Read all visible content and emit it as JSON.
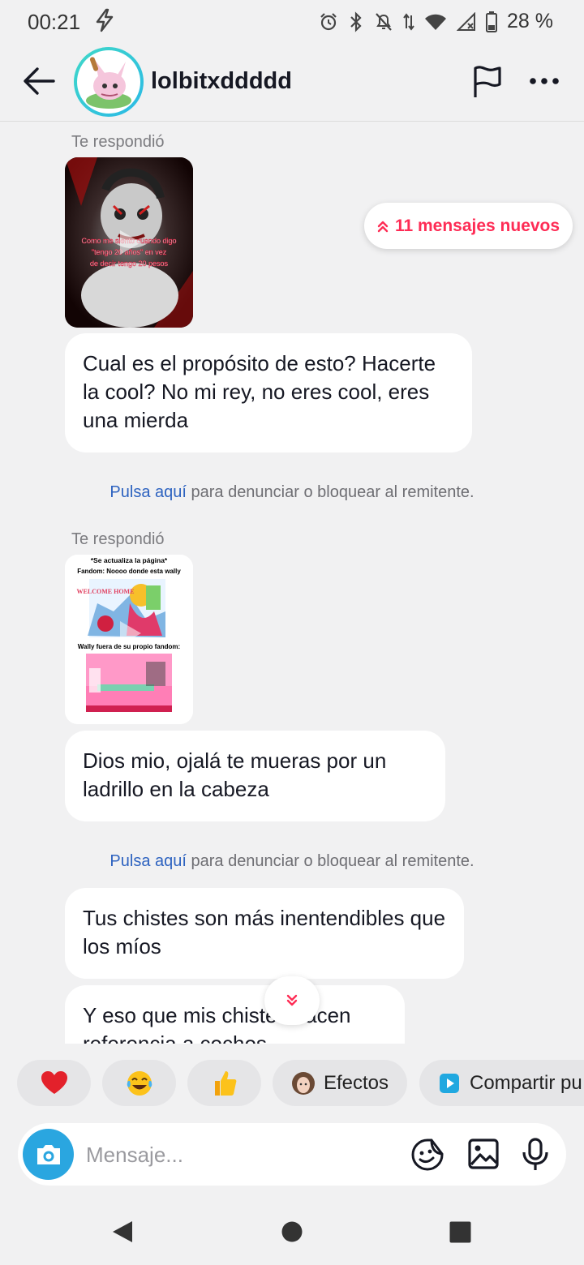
{
  "status_bar": {
    "time": "00:21",
    "battery": "28 %"
  },
  "header": {
    "username": "lolbitxddddd"
  },
  "messages": [
    {
      "replied_label": "Te respondió",
      "video_caption": "Como me siento cuando digo \"tengo 20 años\" en vez de decir tengo 20 pesos",
      "text": "Cual es el propósito de esto? Hacerte la cool? No mi rey, no eres cool, eres una mierda"
    },
    {
      "replied_label": "Te respondió",
      "video_line1": "*Se actualiza la página*",
      "video_line2": "Fandom: Noooo donde esta wally",
      "video_line3": "Wally fuera de su propio fandom:",
      "video_sign": "WELCOME HOME",
      "text": "Dios mio, ojalá te mueras por un ladrillo en la cabeza"
    },
    {
      "text": "Tus chistes son más inentendibles que los míos"
    },
    {
      "text": "Y eso que mis chistes hacen referencia a cochos"
    }
  ],
  "report": {
    "link": "Pulsa aquí",
    "rest": " para denunciar o bloquear al remitente."
  },
  "new_messages": "11 mensajes nuevos",
  "quick_actions": {
    "effects": "Efectos",
    "share": "Compartir pu"
  },
  "composer": {
    "placeholder": "Mensaje..."
  },
  "colors": {
    "accent": "#fe2c55",
    "camera": "#2aa6e0",
    "link": "#2e63c0"
  }
}
